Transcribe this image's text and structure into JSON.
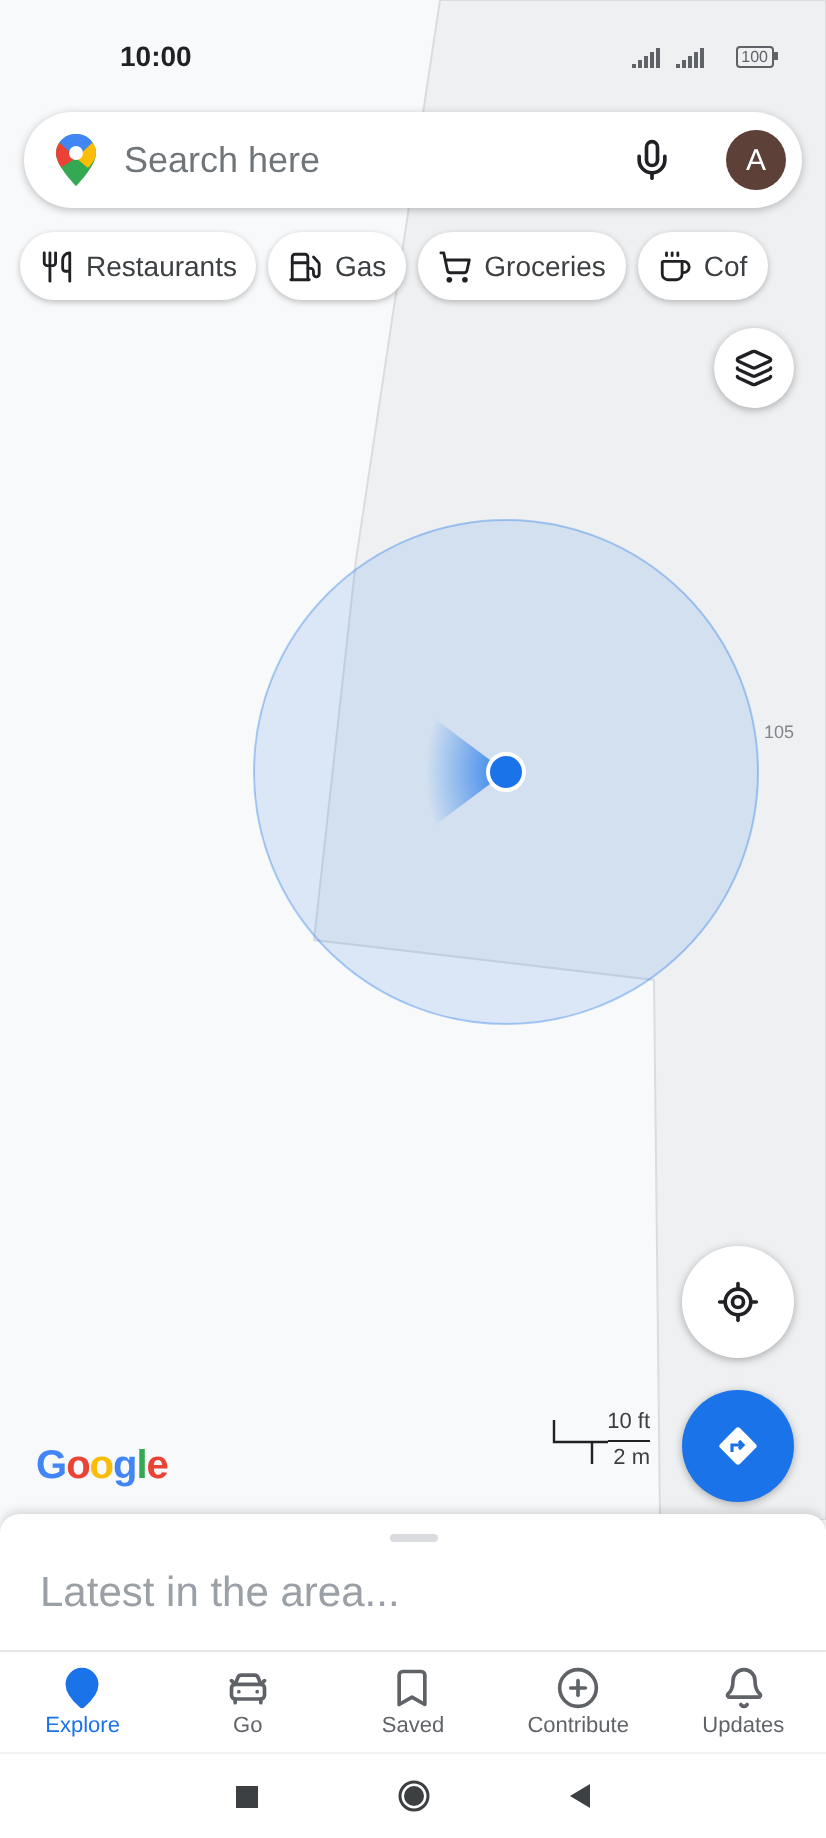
{
  "status_bar": {
    "time": "10:00",
    "battery": "100"
  },
  "search": {
    "placeholder": "Search here",
    "avatar": "A"
  },
  "chips": [
    {
      "label": "Restaurants",
      "kind": "restaurant"
    },
    {
      "label": "Gas",
      "kind": "gas"
    },
    {
      "label": "Groceries",
      "kind": "grocery"
    },
    {
      "label": "Cof",
      "kind": "coffee"
    }
  ],
  "map": {
    "building_number": "105",
    "logo": "Google",
    "scale": {
      "feet": "10 ft",
      "meters": "2 m"
    }
  },
  "sheet": {
    "title": "Latest in the area..."
  },
  "nav": [
    {
      "label": "Explore",
      "kind": "explore",
      "selected": true
    },
    {
      "label": "Go",
      "kind": "go",
      "selected": false
    },
    {
      "label": "Saved",
      "kind": "saved",
      "selected": false
    },
    {
      "label": "Contribute",
      "kind": "contribute",
      "selected": false
    },
    {
      "label": "Updates",
      "kind": "updates",
      "selected": false
    }
  ]
}
